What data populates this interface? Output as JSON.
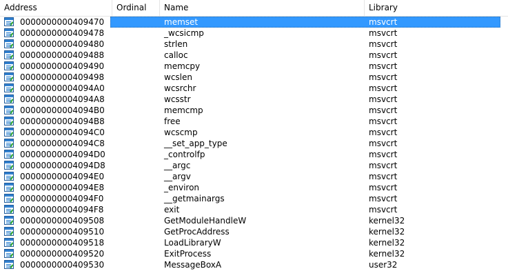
{
  "columns": {
    "address": "Address",
    "ordinal": "Ordinal",
    "name": "Name",
    "library": "Library"
  },
  "rows": [
    {
      "address": "0000000000409470",
      "ordinal": "",
      "name": "memset",
      "library": "msvcrt",
      "selected": true
    },
    {
      "address": "0000000000409478",
      "ordinal": "",
      "name": "_wcsicmp",
      "library": "msvcrt"
    },
    {
      "address": "0000000000409480",
      "ordinal": "",
      "name": "strlen",
      "library": "msvcrt"
    },
    {
      "address": "0000000000409488",
      "ordinal": "",
      "name": "calloc",
      "library": "msvcrt"
    },
    {
      "address": "0000000000409490",
      "ordinal": "",
      "name": "memcpy",
      "library": "msvcrt"
    },
    {
      "address": "0000000000409498",
      "ordinal": "",
      "name": "wcslen",
      "library": "msvcrt"
    },
    {
      "address": "00000000004094A0",
      "ordinal": "",
      "name": "wcsrchr",
      "library": "msvcrt"
    },
    {
      "address": "00000000004094A8",
      "ordinal": "",
      "name": "wcsstr",
      "library": "msvcrt"
    },
    {
      "address": "00000000004094B0",
      "ordinal": "",
      "name": "memcmp",
      "library": "msvcrt"
    },
    {
      "address": "00000000004094B8",
      "ordinal": "",
      "name": "free",
      "library": "msvcrt"
    },
    {
      "address": "00000000004094C0",
      "ordinal": "",
      "name": "wcscmp",
      "library": "msvcrt"
    },
    {
      "address": "00000000004094C8",
      "ordinal": "",
      "name": "__set_app_type",
      "library": "msvcrt"
    },
    {
      "address": "00000000004094D0",
      "ordinal": "",
      "name": "_controlfp",
      "library": "msvcrt"
    },
    {
      "address": "00000000004094D8",
      "ordinal": "",
      "name": "__argc",
      "library": "msvcrt"
    },
    {
      "address": "00000000004094E0",
      "ordinal": "",
      "name": "__argv",
      "library": "msvcrt"
    },
    {
      "address": "00000000004094E8",
      "ordinal": "",
      "name": "_environ",
      "library": "msvcrt"
    },
    {
      "address": "00000000004094F0",
      "ordinal": "",
      "name": "__getmainargs",
      "library": "msvcrt"
    },
    {
      "address": "00000000004094F8",
      "ordinal": "",
      "name": "exit",
      "library": "msvcrt"
    },
    {
      "address": "0000000000409508",
      "ordinal": "",
      "name": "GetModuleHandleW",
      "library": "kernel32"
    },
    {
      "address": "0000000000409510",
      "ordinal": "",
      "name": "GetProcAddress",
      "library": "kernel32"
    },
    {
      "address": "0000000000409518",
      "ordinal": "",
      "name": "LoadLibraryW",
      "library": "kernel32"
    },
    {
      "address": "0000000000409520",
      "ordinal": "",
      "name": "ExitProcess",
      "library": "kernel32"
    },
    {
      "address": "0000000000409530",
      "ordinal": "",
      "name": "MessageBoxA",
      "library": "user32"
    }
  ],
  "row_icon": "import-table-icon",
  "colors": {
    "selection": "#3399ff",
    "icon_blue": "#2f7fcf",
    "icon_green": "#2aa52a"
  }
}
